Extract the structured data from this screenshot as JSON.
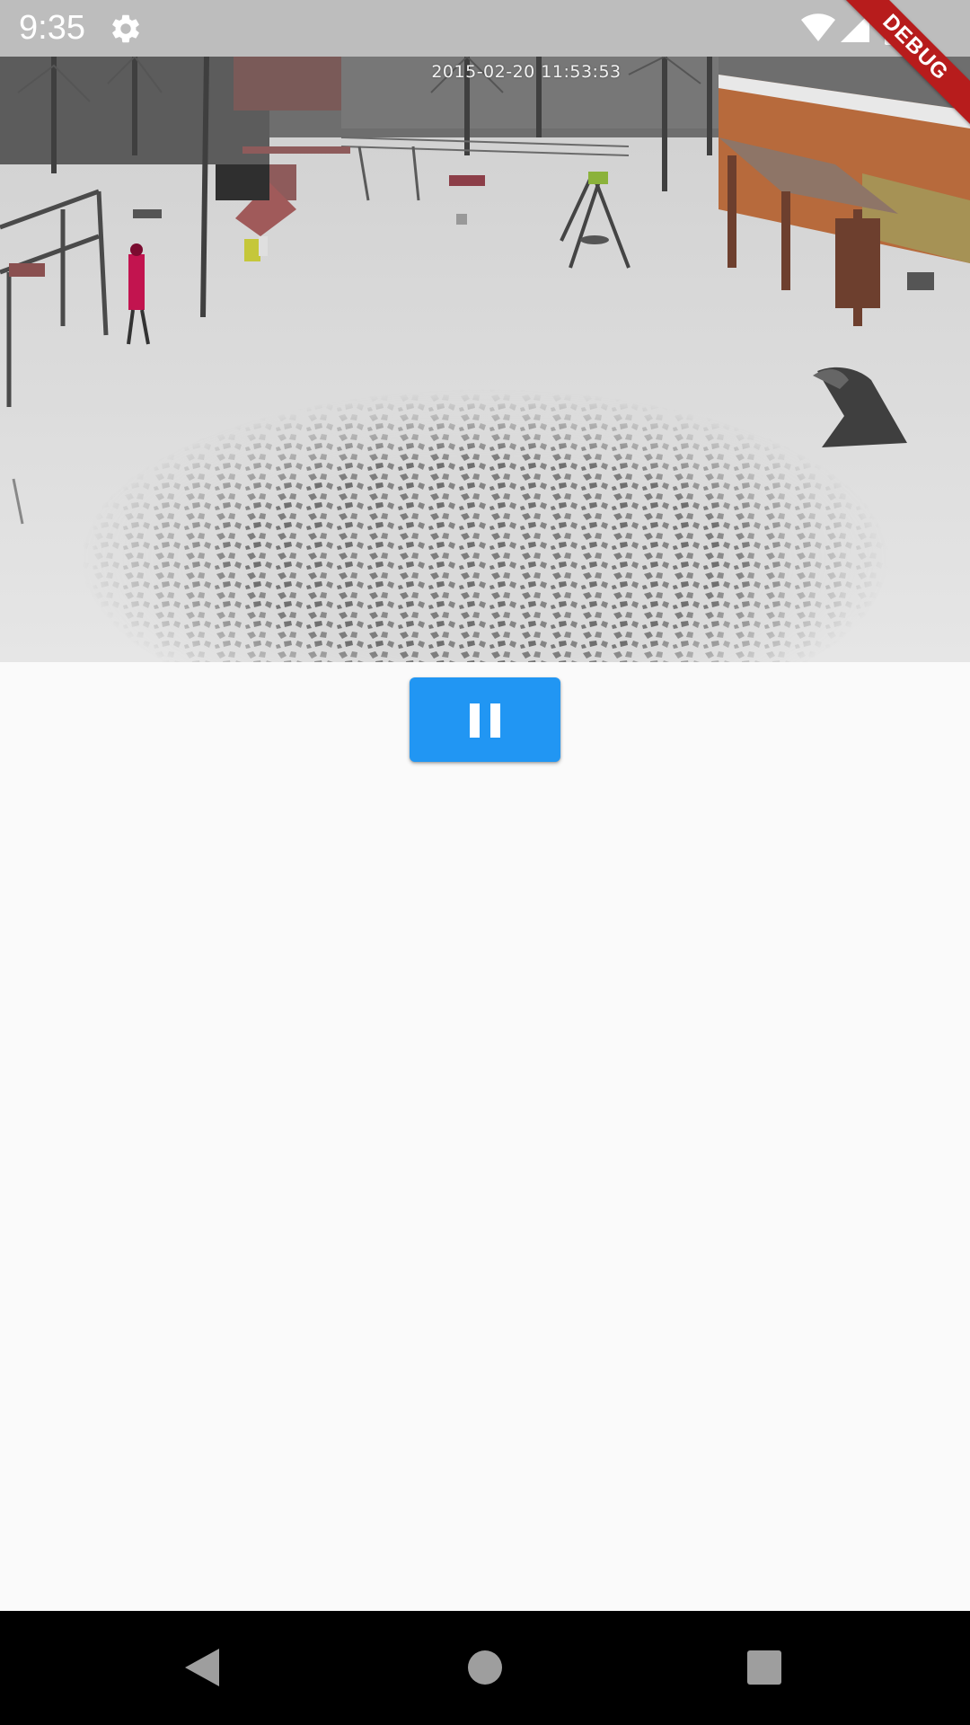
{
  "status_bar": {
    "time": "9:35",
    "icons": [
      "settings-gear-icon",
      "wifi-icon",
      "cell-signal-icon",
      "battery-icon"
    ],
    "background": "#bdbdbd"
  },
  "debug_banner": {
    "label": "DEBUG",
    "color": "#b71c1c"
  },
  "video": {
    "timestamp": "2015-02-20 11:53:53",
    "scene": "snowy-playground-surveillance-frame"
  },
  "controls": {
    "play_pause_state": "playing",
    "button_icon": "pause-icon",
    "button_color": "#2196f3"
  },
  "nav_bar": {
    "buttons": [
      "back-icon",
      "home-icon",
      "recents-icon"
    ]
  }
}
